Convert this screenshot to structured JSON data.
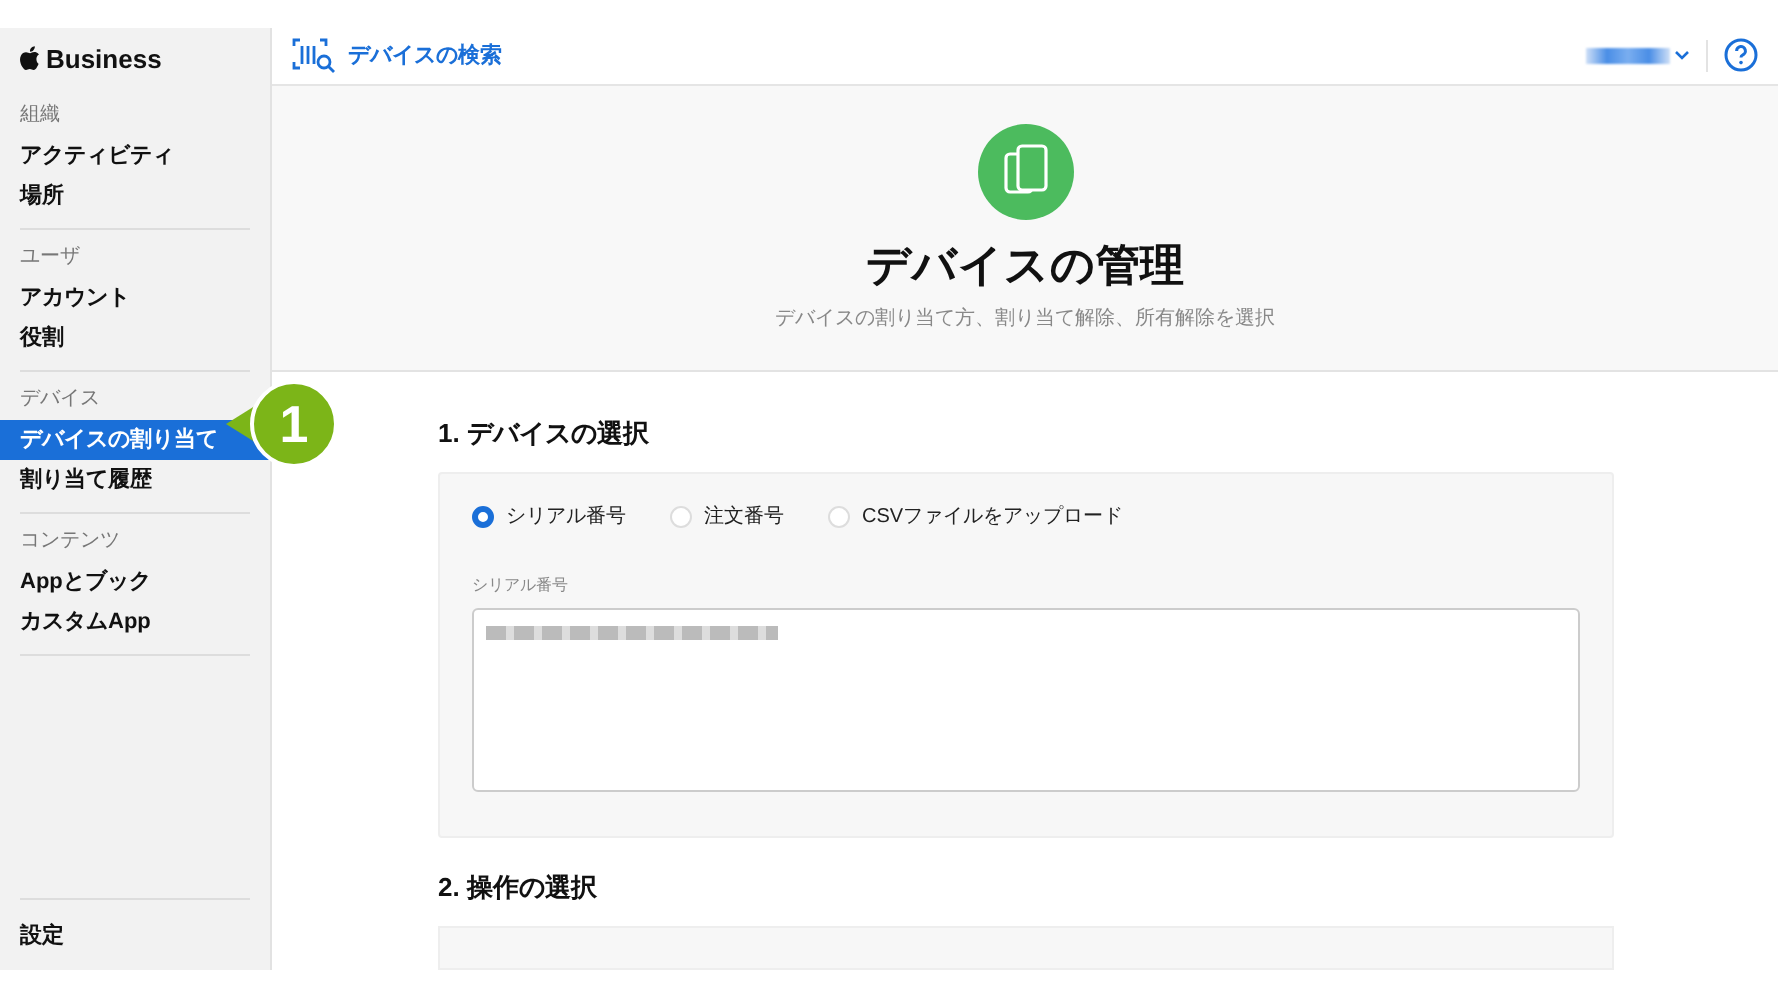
{
  "sidebar": {
    "brand": "Business",
    "groups": [
      {
        "heading": "組織",
        "items": [
          {
            "label": "アクティビティ",
            "selected": false
          },
          {
            "label": "場所",
            "selected": false
          }
        ]
      },
      {
        "heading": "ユーザ",
        "items": [
          {
            "label": "アカウント",
            "selected": false
          },
          {
            "label": "役割",
            "selected": false
          }
        ]
      },
      {
        "heading": "デバイス",
        "items": [
          {
            "label": "デバイスの割り当て",
            "selected": true
          },
          {
            "label": "割り当て履歴",
            "selected": false
          }
        ]
      },
      {
        "heading": "コンテンツ",
        "items": [
          {
            "label": "Appとブック",
            "selected": false
          },
          {
            "label": "カスタムApp",
            "selected": false
          }
        ]
      }
    ],
    "footer": "設定"
  },
  "toolbar": {
    "search_link": "デバイスの検索"
  },
  "hero": {
    "title": "デバイスの管理",
    "subtitle": "デバイスの割り当て方、割り当て解除、所有解除を選択"
  },
  "sections": [
    {
      "title": "1. デバイスの選択",
      "options": [
        {
          "label": "シリアル番号",
          "selected": true
        },
        {
          "label": "注文番号",
          "selected": false
        },
        {
          "label": "CSVファイルをアップロード",
          "selected": false
        }
      ],
      "field_label": "シリアル番号"
    },
    {
      "title": "2. 操作の選択"
    }
  ],
  "callout": {
    "number": "1"
  }
}
